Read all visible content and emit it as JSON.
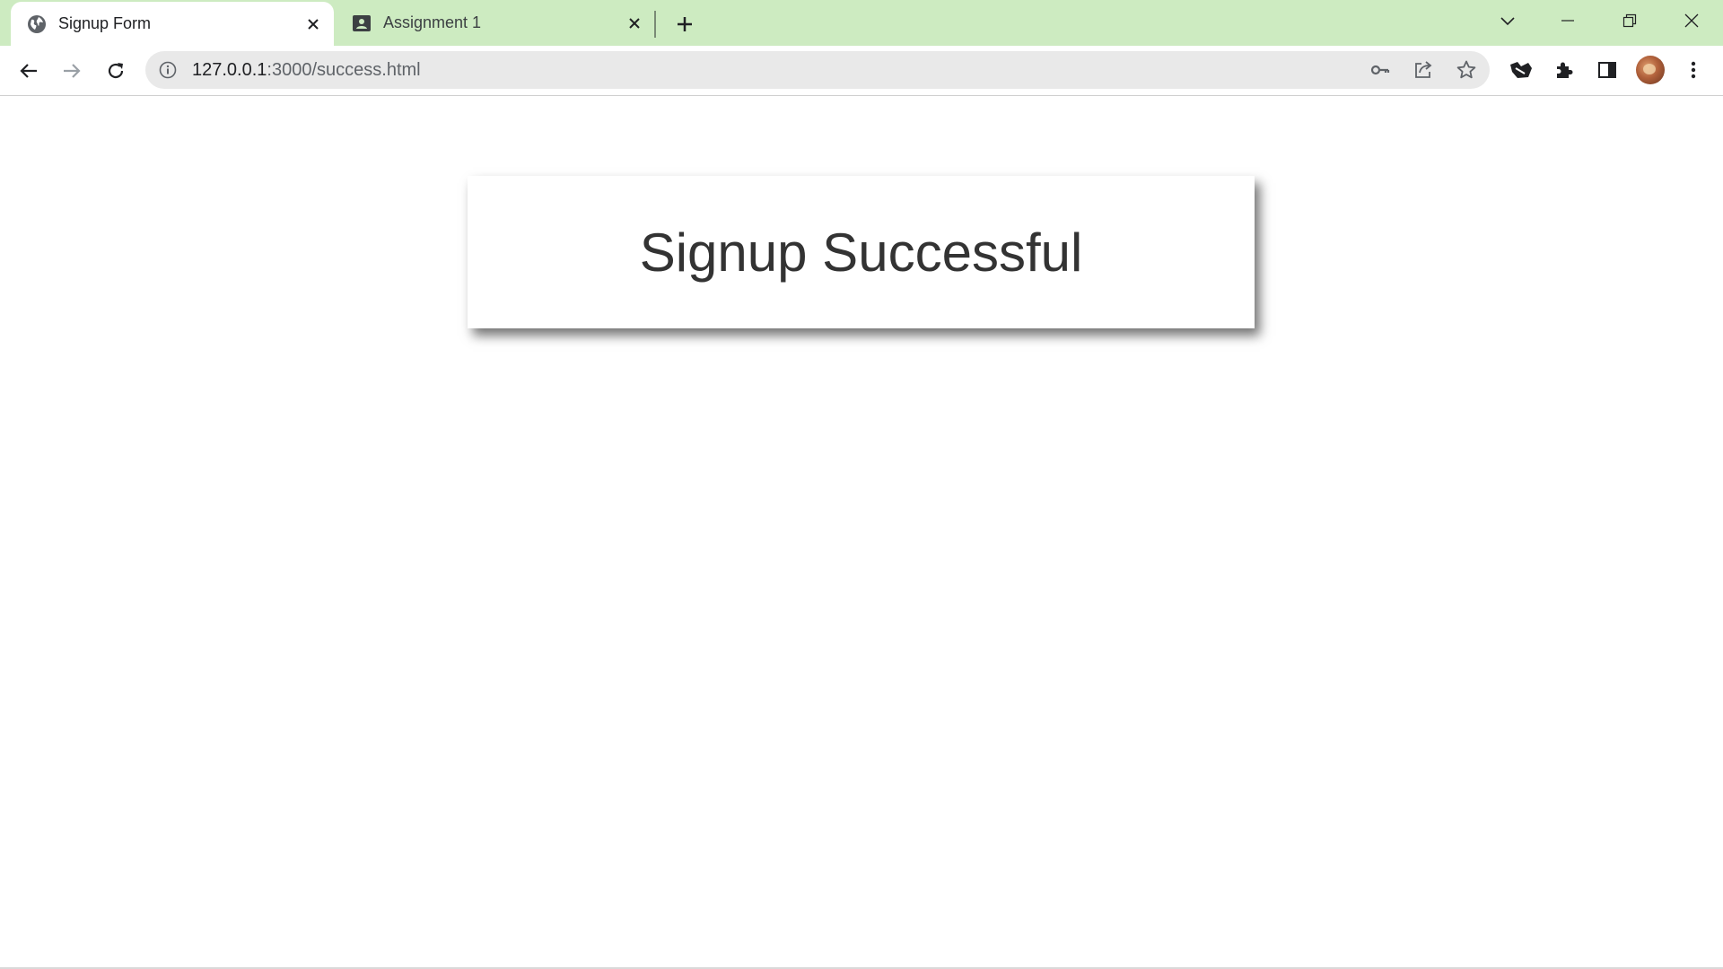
{
  "tabs": [
    {
      "label": "Signup Form",
      "icon": "globe-icon",
      "active": true
    },
    {
      "label": "Assignment 1",
      "icon": "contact-card-icon",
      "active": false
    }
  ],
  "address_bar": {
    "host": "127.0.0.1",
    "path": ":3000/success.html"
  },
  "page": {
    "heading": "Signup Successful"
  },
  "colors": {
    "tabstrip": "#cdebc1",
    "omnibox": "#e9e9e9",
    "heading": "#333333"
  }
}
